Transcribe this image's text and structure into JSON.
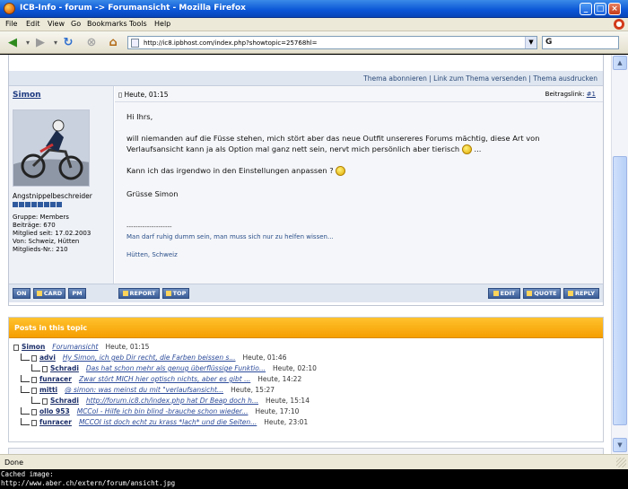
{
  "window": {
    "title": "ICB-Info - forum -> Forumansicht - Mozilla Firefox"
  },
  "menu": [
    "File",
    "Edit",
    "View",
    "Go",
    "Bookmarks",
    "Tools",
    "Help"
  ],
  "nav": {
    "url": "http://ic8.ipbhost.com/index.php?showtopic=25768hl=",
    "search_placeholder": "G"
  },
  "topbar": {
    "links": "Thema abonnieren | Link zum Thema versenden | Thema ausdrucken"
  },
  "post": {
    "author": "Simon",
    "date": "Heute, 01:15",
    "link_label": "Beitragslink:",
    "link_num": "#1",
    "user_title": "Angstnippelbeschreider",
    "pip_count": 8,
    "info": [
      "Gruppe: Members",
      "Beiträge: 670",
      "Mitglied seit: 17.02.2003",
      "Von: Schweiz, Hütten",
      "Mitglieds-Nr.: 210"
    ],
    "body": {
      "greeting": "Hi Ihrs,",
      "p1a": "will niemanden auf die Füsse stehen, mich stört aber das neue Outfit unsereres Forums mächtig, diese Art von",
      "p1b": "Verlaufsansicht kann ja als Option mal ganz nett sein, nervt mich persönlich aber tierisch",
      "p1c": "...",
      "p2": "Kann ich das irgendwo in den Einstellungen anpassen ?",
      "p3": "Grüsse Simon"
    },
    "sig": {
      "line": "--------------------",
      "quote": "Man darf ruhig dumm sein, man muss sich nur zu helfen wissen...",
      "place": "Hütten, Schweiz"
    },
    "buttons_left": [
      "ON",
      "CARD",
      "PM"
    ],
    "buttons_mid": [
      "REPORT",
      "TOP"
    ],
    "buttons_right": [
      "EDIT",
      "QUOTE",
      "REPLY"
    ]
  },
  "topic": {
    "heading": "Posts in this topic",
    "rows": [
      {
        "user": "Simon",
        "text": "Forumansicht",
        "time": "Heute, 01:15"
      },
      {
        "user": "advi",
        "text": "Hy Simon, ich geb Dir recht, die Farben beissen s...",
        "time": "Heute, 01:46"
      },
      {
        "user": "Schradi",
        "text": "Das hat schon mehr als genug überflüssige Funktio...",
        "time": "Heute, 02:10"
      },
      {
        "user": "funracer",
        "text": "Zwar stört MICH hier optisch nichts, aber es gibt ...",
        "time": "Heute, 14:22"
      },
      {
        "user": "mitti",
        "text": "@ simon: was meinst du mit \"verlaufsansicht...",
        "time": "Heute, 15:27"
      },
      {
        "user": "Schradi",
        "text": "http://forum.ic8.ch/index.php hat Dr Beap doch h...",
        "time": "Heute, 15:14"
      },
      {
        "user": "ollo 953",
        "text": "MCCol - Hilfe ich bin blind -brauche schon wieder...",
        "time": "Heute, 17:10"
      },
      {
        "user": "funracer",
        "text": "MCCOI ist doch echt zu krass *lach* und die Seiten...",
        "time": "Heute, 23:01"
      }
    ]
  },
  "status": {
    "text": "Done"
  },
  "caption": {
    "line1": "Cached image:",
    "line2": "http://www.aber.ch/extern/forum/ansicht.jpg"
  }
}
